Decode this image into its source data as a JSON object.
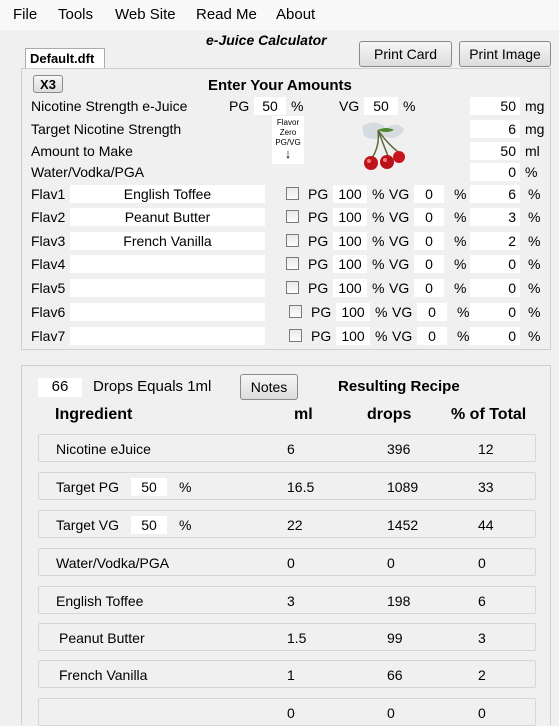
{
  "menu": [
    "File",
    "Tools",
    "Web Site",
    "Read Me",
    "About"
  ],
  "app_title": "e-Juice Calculator",
  "file_tab": "Default.dft",
  "buttons": {
    "print_card": "Print Card",
    "print_image": "Print Image",
    "x3": "X3",
    "notes": "Notes"
  },
  "amounts": {
    "heading": "Enter Your Amounts",
    "nicotine_label": "Nicotine Strength e-Juice",
    "pg_label": "PG",
    "pg_value": "50",
    "vg_label": "VG",
    "vg_value": "50",
    "pct": "%",
    "nicotine_value": "50",
    "nicotine_unit": "mg",
    "target_label": "Target Nicotine Strength",
    "target_value": "6",
    "target_unit": "mg",
    "amount_label": "Amount to Make",
    "amount_value": "50",
    "amount_unit": "ml",
    "water_label": "Water/Vodka/PGA",
    "water_value": "0",
    "water_unit": "%",
    "flavor_zero": [
      "Flavor",
      "Zero",
      "PG/VG"
    ],
    "flavors": [
      {
        "label": "Flav1",
        "name": "English Toffee",
        "pg": "100",
        "vg": "0",
        "pct": "6"
      },
      {
        "label": "Flav2",
        "name": "Peanut Butter",
        "pg": "100",
        "vg": "0",
        "pct": "3"
      },
      {
        "label": "Flav3",
        "name": "French Vanilla",
        "pg": "100",
        "vg": "0",
        "pct": "2"
      },
      {
        "label": "Flav4",
        "name": "",
        "pg": "100",
        "vg": "0",
        "pct": "0"
      },
      {
        "label": "Flav5",
        "name": "",
        "pg": "100",
        "vg": "0",
        "pct": "0"
      },
      {
        "label": "Flav6",
        "name": "",
        "pg": "100",
        "vg": "0",
        "pct": "0"
      },
      {
        "label": "Flav7",
        "name": "",
        "pg": "100",
        "vg": "0",
        "pct": "0"
      }
    ]
  },
  "recipe": {
    "drops_value": "66",
    "drops_label": "Drops Equals 1ml",
    "heading": "Resulting Recipe",
    "columns": [
      "Ingredient",
      "ml",
      "drops",
      "% of Total"
    ],
    "rows": [
      {
        "name": "Nicotine eJuice",
        "ml": "6",
        "drops": "396",
        "pct": "12"
      },
      {
        "name": "Target PG",
        "sub": "50",
        "subpct": "%",
        "ml": "16.5",
        "drops": "1089",
        "pct": "33"
      },
      {
        "name": "Target VG",
        "sub": "50",
        "subpct": "%",
        "ml": "22",
        "drops": "1452",
        "pct": "44"
      },
      {
        "name": "Water/Vodka/PGA",
        "ml": "0",
        "drops": "0",
        "pct": "0"
      },
      {
        "name": "English Toffee",
        "ml": "3",
        "drops": "198",
        "pct": "6"
      },
      {
        "name": "Peanut Butter",
        "ml": "1.5",
        "drops": "99",
        "pct": "3"
      },
      {
        "name": "French Vanilla",
        "ml": "1",
        "drops": "66",
        "pct": "2"
      },
      {
        "name": "",
        "ml": "0",
        "drops": "0",
        "pct": "0"
      }
    ]
  },
  "colors": {
    "background": "#f0f0f0",
    "field": "#ffffff",
    "cherry": "#c0141c"
  }
}
